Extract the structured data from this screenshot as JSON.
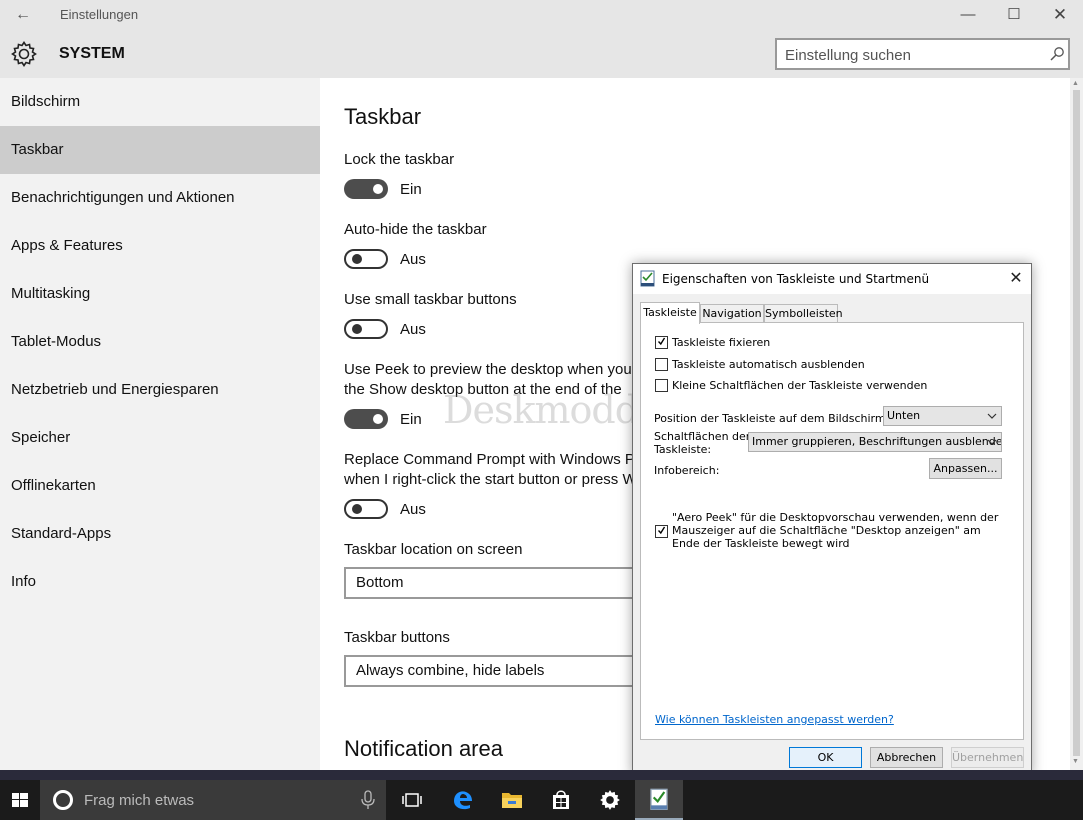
{
  "window": {
    "title": "Einstellungen",
    "back_glyph": "←",
    "minimize_glyph": "—",
    "maximize_glyph": "☐",
    "close_glyph": "✕"
  },
  "header": {
    "title": "SYSTEM",
    "search_placeholder": "Einstellung suchen"
  },
  "sidebar": {
    "items": [
      {
        "label": "Bildschirm"
      },
      {
        "label": "Taskbar"
      },
      {
        "label": "Benachrichtigungen und Aktionen"
      },
      {
        "label": "Apps & Features"
      },
      {
        "label": "Multitasking"
      },
      {
        "label": "Tablet-Modus"
      },
      {
        "label": "Netzbetrieb und Energiesparen"
      },
      {
        "label": "Speicher"
      },
      {
        "label": "Offlinekarten"
      },
      {
        "label": "Standard-Apps"
      },
      {
        "label": "Info"
      }
    ],
    "active_index": 1
  },
  "main": {
    "heading": "Taskbar",
    "settings": [
      {
        "label": "Lock the taskbar",
        "state": "Ein",
        "on": true
      },
      {
        "label": "Auto-hide the taskbar",
        "state": "Aus",
        "on": false
      },
      {
        "label": "Use small taskbar buttons",
        "state": "Aus",
        "on": false
      },
      {
        "label_line1": "Use Peek to preview the desktop when you",
        "label_line2": "the Show desktop button at the end of the",
        "state": "Ein",
        "on": true
      },
      {
        "label_line1": "Replace Command Prompt with Windows Po",
        "label_line2": "when I right-click the start button or press W",
        "state": "Aus",
        "on": false
      }
    ],
    "location_label": "Taskbar location on screen",
    "location_value": "Bottom",
    "buttons_label": "Taskbar buttons",
    "buttons_value": "Always combine, hide labels",
    "notification_heading": "Notification area"
  },
  "watermark": "Deskmodder.de",
  "dialog": {
    "title": "Eigenschaften von Taskleiste und Startmenü",
    "tabs": [
      {
        "label": "Taskleiste"
      },
      {
        "label": "Navigation"
      },
      {
        "label": "Symbolleisten"
      }
    ],
    "checkboxes": [
      {
        "label": "Taskleiste fixieren",
        "checked": true
      },
      {
        "label": "Taskleiste automatisch ausblenden",
        "checked": false
      },
      {
        "label": "Kleine Schaltflächen der Taskleiste verwenden",
        "checked": false
      }
    ],
    "position_label": "Position der Taskleiste auf dem Bildschirm:",
    "position_value": "Unten",
    "buttons_label_1": "Schaltflächen der",
    "buttons_label_2": "Taskleiste:",
    "buttons_value": "Immer gruppieren, Beschriftungen ausblenden",
    "infobereich_label": "Infobereich:",
    "customize_button": "Anpassen...",
    "aero_peek_label": "\"Aero Peek\" für die Desktopvorschau verwenden, wenn der Mauszeiger auf die Schaltfläche \"Desktop anzeigen\" am Ende der Taskleiste bewegt wird",
    "aero_peek_checked": true,
    "help_link": "Wie können Taskleisten angepasst werden?",
    "ok_button": "OK",
    "cancel_button": "Abbrechen",
    "apply_button": "Übernehmen"
  },
  "taskbar": {
    "search_placeholder": "Frag mich etwas",
    "icons": [
      "task-view-icon",
      "edge-icon",
      "file-explorer-icon",
      "store-icon",
      "settings-icon",
      "taskbar-properties-icon"
    ]
  },
  "colors": {
    "accent_blue": "#0078d7",
    "sidebar_bg": "#f2f2f2",
    "active_item_bg": "#cccccc",
    "taskbar_bg": "#1b1b1b"
  }
}
